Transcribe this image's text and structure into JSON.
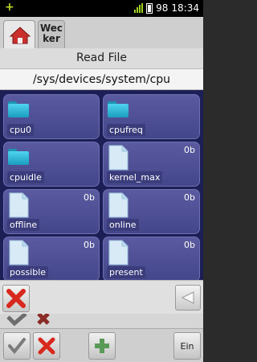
{
  "status_bar": {
    "notification": "+",
    "battery": "98",
    "time": "18:34"
  },
  "tabs": {
    "home": "home-icon",
    "wecker": "Wecker"
  },
  "dialog": {
    "title": "Read File",
    "path": "/sys/devices/system/cpu",
    "items": [
      {
        "name": "cpu0",
        "type": "folder",
        "size": ""
      },
      {
        "name": "cpufreq",
        "type": "folder",
        "size": ""
      },
      {
        "name": "cpuidle",
        "type": "folder",
        "size": ""
      },
      {
        "name": "kernel_max",
        "type": "file",
        "size": "0b"
      },
      {
        "name": "offline",
        "type": "file",
        "size": "0b"
      },
      {
        "name": "online",
        "type": "file",
        "size": "0b"
      },
      {
        "name": "possible",
        "type": "file",
        "size": "0b"
      },
      {
        "name": "present",
        "type": "file",
        "size": "0b"
      }
    ]
  },
  "toolbar": {
    "ein_label": "Ein"
  },
  "colors": {
    "grid_bg": "#1b1f55",
    "cell": "#4a4c90",
    "folder": "#29b3d6",
    "accent_green": "#9fd11f",
    "cancel_red": "#d8281e"
  }
}
